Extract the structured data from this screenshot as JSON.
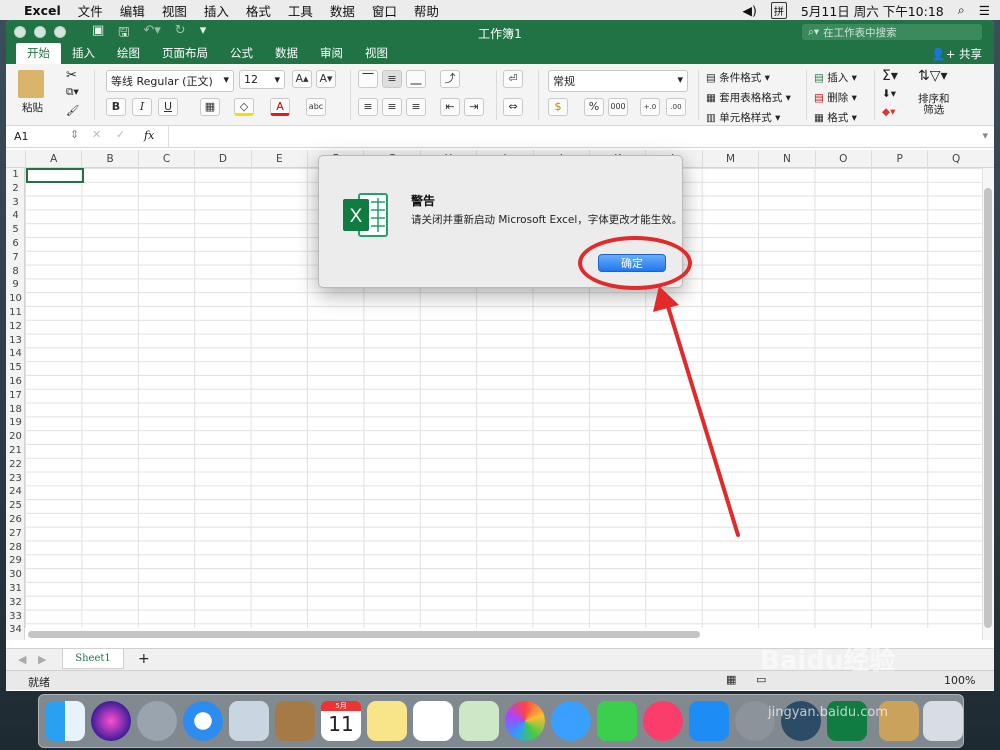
{
  "menubar": {
    "app": "Excel",
    "items": [
      "文件",
      "编辑",
      "视图",
      "插入",
      "格式",
      "工具",
      "数据",
      "窗口",
      "帮助"
    ],
    "date": "5月11日 周六 下午10:18"
  },
  "window": {
    "title": "工作簿1",
    "search_placeholder": "在工作表中搜索",
    "share": "共享"
  },
  "tabs": [
    "开始",
    "插入",
    "绘图",
    "页面布局",
    "公式",
    "数据",
    "审阅",
    "视图"
  ],
  "ribbon": {
    "paste": "粘贴",
    "font_name": "等线 Regular (正文)",
    "font_size": "12",
    "number_format": "常规",
    "conditional_format": "条件格式",
    "format_as_table": "套用表格格式",
    "cell_styles": "单元格样式",
    "insert": "插入",
    "delete": "删除",
    "format": "格式",
    "sort_filter": "排序和\n筛选",
    "percent": "%",
    "thousands": "000",
    "dec_inc": "←.0\n.00",
    "dec_dec": ".00\n→.0"
  },
  "formula_bar": {
    "name_box": "A1",
    "fx": "fx"
  },
  "columns": [
    "A",
    "B",
    "C",
    "D",
    "E",
    "F",
    "G",
    "H",
    "I",
    "J",
    "K",
    "L",
    "M",
    "N",
    "O",
    "P",
    "Q"
  ],
  "rows": [
    "1",
    "2",
    "3",
    "4",
    "5",
    "6",
    "7",
    "8",
    "9",
    "10",
    "11",
    "12",
    "13",
    "14",
    "15",
    "16",
    "17",
    "18",
    "19",
    "20",
    "21",
    "22",
    "23",
    "24",
    "25",
    "26",
    "27",
    "28",
    "29",
    "30",
    "31",
    "32",
    "33",
    "34"
  ],
  "sheet": {
    "tab": "Sheet1",
    "add": "+"
  },
  "status": {
    "ready": "就绪",
    "zoom": "100%"
  },
  "dialog": {
    "title": "警告",
    "message": "请关闭并重新启动 Microsoft Excel，字体更改才能生效。",
    "ok": "确定"
  },
  "dock": {
    "calendar_month": "5月",
    "calendar_day": "11"
  },
  "watermark": {
    "text": "Baidu经验",
    "url": "jingyan.baidu.com"
  },
  "colors": {
    "excel_green": "#217346",
    "annotation_red": "#e22a2a",
    "ok_blue": "#1f77f0"
  }
}
